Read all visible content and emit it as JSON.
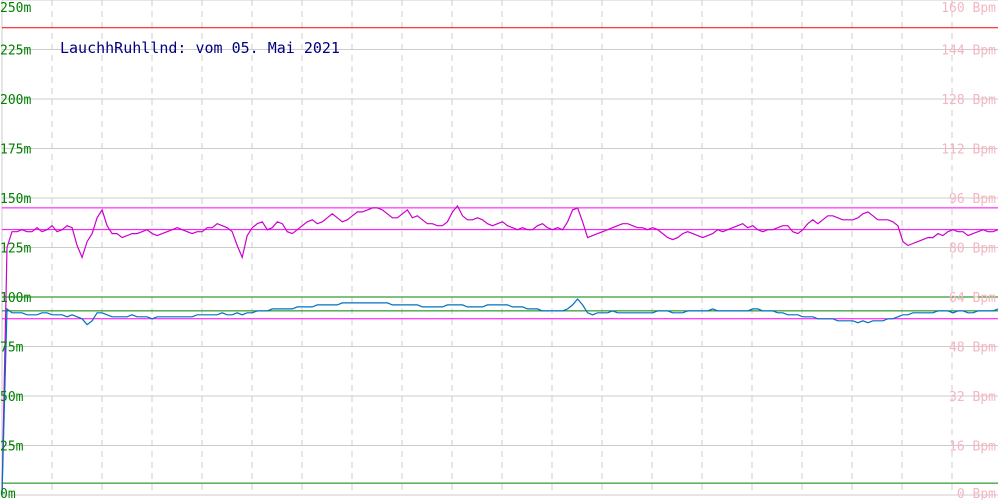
{
  "chart_data": {
    "type": "line",
    "title": "LauchhRuhllnd: vom 05. Mai 2021",
    "x_count": 200,
    "grid": true,
    "left_axis": {
      "ticks": [
        {
          "value": 250,
          "label": "250m"
        },
        {
          "value": 225,
          "label": "225m"
        },
        {
          "value": 200,
          "label": "200m"
        },
        {
          "value": 175,
          "label": "175m"
        },
        {
          "value": 150,
          "label": "150m"
        },
        {
          "value": 125,
          "label": "125m"
        },
        {
          "value": 100,
          "label": "100m"
        },
        {
          "value": 75,
          "label": "75m"
        },
        {
          "value": 50,
          "label": "50m"
        },
        {
          "value": 25,
          "label": "25m"
        },
        {
          "value": 0,
          "label": "0m"
        }
      ],
      "range": [
        0,
        250
      ]
    },
    "right_axis": {
      "ticks": [
        {
          "value": 160,
          "label": "160 Bpm"
        },
        {
          "value": 144,
          "label": "144 Bpm"
        },
        {
          "value": 128,
          "label": "128 Bpm"
        },
        {
          "value": 112,
          "label": "112 Bpm"
        },
        {
          "value": 96,
          "label": "96 Bpm"
        },
        {
          "value": 80,
          "label": "80 Bpm"
        },
        {
          "value": 64,
          "label": "64 Bpm"
        },
        {
          "value": 48,
          "label": "48 Bpm"
        },
        {
          "value": 32,
          "label": "32 Bpm"
        },
        {
          "value": 16,
          "label": "16 Bpm"
        },
        {
          "value": 0,
          "label": "0 Bpm"
        }
      ],
      "range": [
        0,
        160
      ]
    },
    "reference_lines": [
      {
        "axis": "left",
        "value": 236,
        "color": "#ff0000"
      },
      {
        "axis": "left",
        "value": 145,
        "color": "#ff00ff"
      },
      {
        "axis": "left",
        "value": 134,
        "color": "#ff00ff"
      },
      {
        "axis": "left",
        "value": 100,
        "color": "#008000"
      },
      {
        "axis": "left",
        "value": 93,
        "color": "#008000"
      },
      {
        "axis": "left",
        "value": 89,
        "color": "#ff00ff"
      },
      {
        "axis": "left",
        "value": 6,
        "color": "#008000"
      }
    ],
    "series": [
      {
        "color": "#cc00cc",
        "values": [
          0,
          125,
          133,
          133,
          134,
          133,
          133,
          135,
          133,
          134,
          136,
          133,
          134,
          136,
          135,
          126,
          120,
          128,
          132,
          140,
          144,
          136,
          132,
          132,
          130,
          131,
          132,
          132,
          133,
          134,
          132,
          131,
          132,
          133,
          134,
          135,
          134,
          133,
          132,
          133,
          133,
          135,
          135,
          137,
          136,
          135,
          133,
          126,
          120,
          131,
          135,
          137,
          138,
          134,
          135,
          138,
          137,
          133,
          132,
          134,
          136,
          138,
          139,
          137,
          138,
          140,
          142,
          140,
          138,
          139,
          141,
          143,
          143,
          144,
          145,
          145,
          144,
          142,
          140,
          140,
          142,
          144,
          140,
          141,
          139,
          137,
          137,
          136,
          136,
          138,
          143,
          146,
          141,
          139,
          139,
          140,
          139,
          137,
          136,
          137,
          138,
          136,
          135,
          134,
          135,
          134,
          134,
          136,
          137,
          135,
          134,
          135,
          134,
          138,
          144,
          145,
          138,
          130,
          131,
          132,
          133,
          134,
          135,
          136,
          137,
          137,
          136,
          135,
          135,
          134,
          135,
          134,
          132,
          130,
          129,
          130,
          132,
          133,
          132,
          131,
          130,
          131,
          132,
          134,
          133,
          134,
          135,
          136,
          137,
          135,
          136,
          134,
          133,
          134,
          134,
          135,
          136,
          136,
          133,
          132,
          134,
          137,
          139,
          137,
          139,
          141,
          141,
          140,
          139,
          139,
          139,
          140,
          142,
          143,
          141,
          139,
          139,
          139,
          138,
          136,
          128,
          126,
          127,
          128,
          129,
          130,
          130,
          132,
          131,
          133,
          134,
          133,
          133,
          131,
          132,
          133,
          134,
          133,
          133,
          134
        ]
      },
      {
        "color": "#0070c0",
        "values": [
          0,
          94,
          92,
          92,
          92,
          91,
          91,
          91,
          92,
          92,
          91,
          91,
          91,
          90,
          91,
          90,
          89,
          86,
          88,
          92,
          92,
          91,
          90,
          90,
          90,
          90,
          91,
          90,
          90,
          90,
          89,
          90,
          90,
          90,
          90,
          90,
          90,
          90,
          90,
          91,
          91,
          91,
          91,
          91,
          92,
          91,
          91,
          92,
          91,
          92,
          92,
          93,
          93,
          93,
          94,
          94,
          94,
          94,
          94,
          95,
          95,
          95,
          95,
          96,
          96,
          96,
          96,
          96,
          97,
          97,
          97,
          97,
          97,
          97,
          97,
          97,
          97,
          97,
          96,
          96,
          96,
          96,
          96,
          96,
          95,
          95,
          95,
          95,
          95,
          96,
          96,
          96,
          96,
          95,
          95,
          95,
          95,
          96,
          96,
          96,
          96,
          96,
          95,
          95,
          95,
          94,
          94,
          94,
          93,
          93,
          93,
          93,
          93,
          94,
          96,
          99,
          96,
          92,
          91,
          92,
          92,
          92,
          93,
          92,
          92,
          92,
          92,
          92,
          92,
          92,
          92,
          93,
          93,
          93,
          92,
          92,
          92,
          93,
          93,
          93,
          93,
          93,
          94,
          93,
          93,
          93,
          93,
          93,
          93,
          93,
          94,
          94,
          93,
          93,
          93,
          92,
          92,
          91,
          91,
          91,
          90,
          90,
          90,
          89,
          89,
          89,
          89,
          88,
          88,
          88,
          88,
          87,
          88,
          87,
          88,
          88,
          88,
          89,
          89,
          90,
          91,
          91,
          92,
          92,
          92,
          92,
          92,
          93,
          93,
          93,
          92,
          93,
          93,
          92,
          92,
          93,
          93,
          93,
          93,
          94
        ]
      }
    ]
  },
  "colors": {
    "grid": "#cccccc",
    "left_axis": "#008000",
    "right_axis": "#f4b6c2",
    "title": "#000080"
  }
}
